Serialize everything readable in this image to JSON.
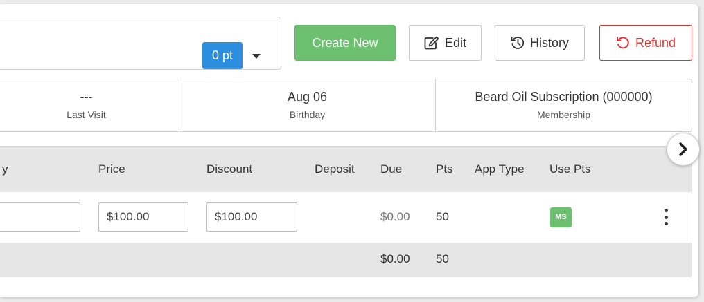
{
  "points_badge": "0 pt",
  "toolbar": {
    "create_label": "Create New",
    "edit_label": "Edit",
    "history_label": "History",
    "refund_label": "Refund"
  },
  "info": {
    "last_visit_value": "---",
    "last_visit_label": "Last Visit",
    "birthday_value": "Aug 06",
    "birthday_label": "Birthday",
    "membership_value": "Beard Oil Subscription (000000)",
    "membership_label": "Membership"
  },
  "table": {
    "headers": [
      "y",
      "Price",
      "Discount",
      "Deposit",
      "Due",
      "Pts",
      "App Type",
      "Use Pts"
    ],
    "row": {
      "first_input": "",
      "price": "$100.00",
      "discount": "$100.00",
      "due": "$0.00",
      "pts": "50",
      "use_pts_badge": "MS"
    },
    "footer": {
      "due_total": "$0.00",
      "pts_total": "50"
    }
  },
  "colors": {
    "primary_blue": "#2b8ede",
    "success_green": "#6cc070",
    "danger_red": "#dd3333"
  },
  "icons": {
    "caret": "caret-down-icon",
    "edit": "edit-icon",
    "history": "history-icon",
    "refund": "refund-icon",
    "next": "chevron-right-icon",
    "more": "more-vertical-icon"
  }
}
